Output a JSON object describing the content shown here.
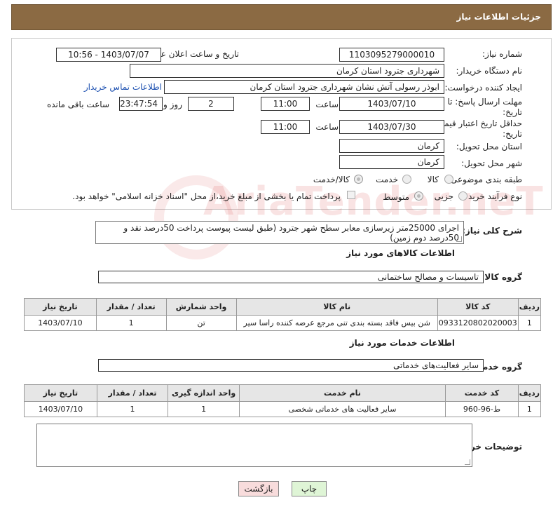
{
  "header": {
    "title": "جزئیات اطلاعات نیاز"
  },
  "form": {
    "need_number_label": "شماره نیاز:",
    "need_number": "1103095279000010",
    "announce_label": "تاریخ و ساعت اعلان عمومی:",
    "announce_value": "1403/07/07 - 10:56",
    "buyer_org_label": "نام دستگاه خریدار:",
    "buyer_org": "شهرداری جترود استان کرمان",
    "requester_label": "ایجاد کننده درخواست:",
    "requester": "ابوذر رسولی آتش نشان شهرداری جترود استان کرمان",
    "contact_link": "اطلاعات تماس خریدار",
    "deadline_label": "مهلت ارسال پاسخ: تا تاریخ:",
    "deadline_date": "1403/07/10",
    "time_label": "ساعت",
    "deadline_time": "11:00",
    "days_value": "2",
    "days_label": "روز و",
    "remaining_time": "23:47:54",
    "remaining_label": "ساعت باقی مانده",
    "validity_label": "حداقل تاریخ اعتبار قیمت: تا تاریخ:",
    "validity_date": "1403/07/30",
    "validity_time": "11:00",
    "province_label": "استان محل تحویل:",
    "province": "کرمان",
    "city_label": "شهر محل تحویل:",
    "city": "کرمان",
    "category_label": "طبقه بندی موضوعی:",
    "category_options": [
      "کالا",
      "خدمت",
      "کالا/خدمت"
    ],
    "process_label": "نوع فرآیند خرید :",
    "process_options": [
      "جزیی",
      "متوسط"
    ],
    "payment_note": "پرداخت تمام یا بخشی از مبلغ خرید،از محل \"اسناد خزانه اسلامی\" خواهد بود."
  },
  "description": {
    "label": "شرح کلی نیاز:",
    "text": "اجرای 25000متر زیرسازی معابر سطح شهر جترود (طبق لیست پیوست پرداخت 50درصد نقد و 50درصد دوم زمین)"
  },
  "goods": {
    "section_title": "اطلاعات کالاهای مورد نیاز",
    "group_label": "گروه کالا:",
    "group_value": "تاسیسات و مصالح ساختمانی",
    "headers": [
      "ردیف",
      "کد کالا",
      "نام کالا",
      "واحد شمارش",
      "تعداد / مقدار",
      "تاریخ نیاز"
    ],
    "rows": [
      [
        "1",
        "0933120802020003",
        "شن بیس فاقد بسته بندی تنی مرجع عرضه کننده راسا سیر",
        "تن",
        "1",
        "1403/07/10"
      ]
    ]
  },
  "services": {
    "section_title": "اطلاعات خدمات مورد نیاز",
    "group_label": "گروه خدمت:",
    "group_value": "سایر فعالیت‌های خدماتی",
    "headers": [
      "ردیف",
      "کد خدمت",
      "نام خدمت",
      "واحد اندازه گیری",
      "تعداد / مقدار",
      "تاریخ نیاز"
    ],
    "rows": [
      [
        "1",
        "ط-96-960",
        "سایر فعالیت های خدماتی شخصی",
        "1",
        "1",
        "1403/07/10"
      ]
    ]
  },
  "buyer_notes": {
    "label": "توضیحات خریدار:"
  },
  "buttons": {
    "print": "چاپ",
    "back": "بازگشت"
  },
  "watermark": "AriaTender.neT",
  "colors": {
    "header_bg": "#8b6a43",
    "print_btn": "#dff5d6",
    "back_btn": "#f8dcdc",
    "link": "#1b4fb0"
  }
}
